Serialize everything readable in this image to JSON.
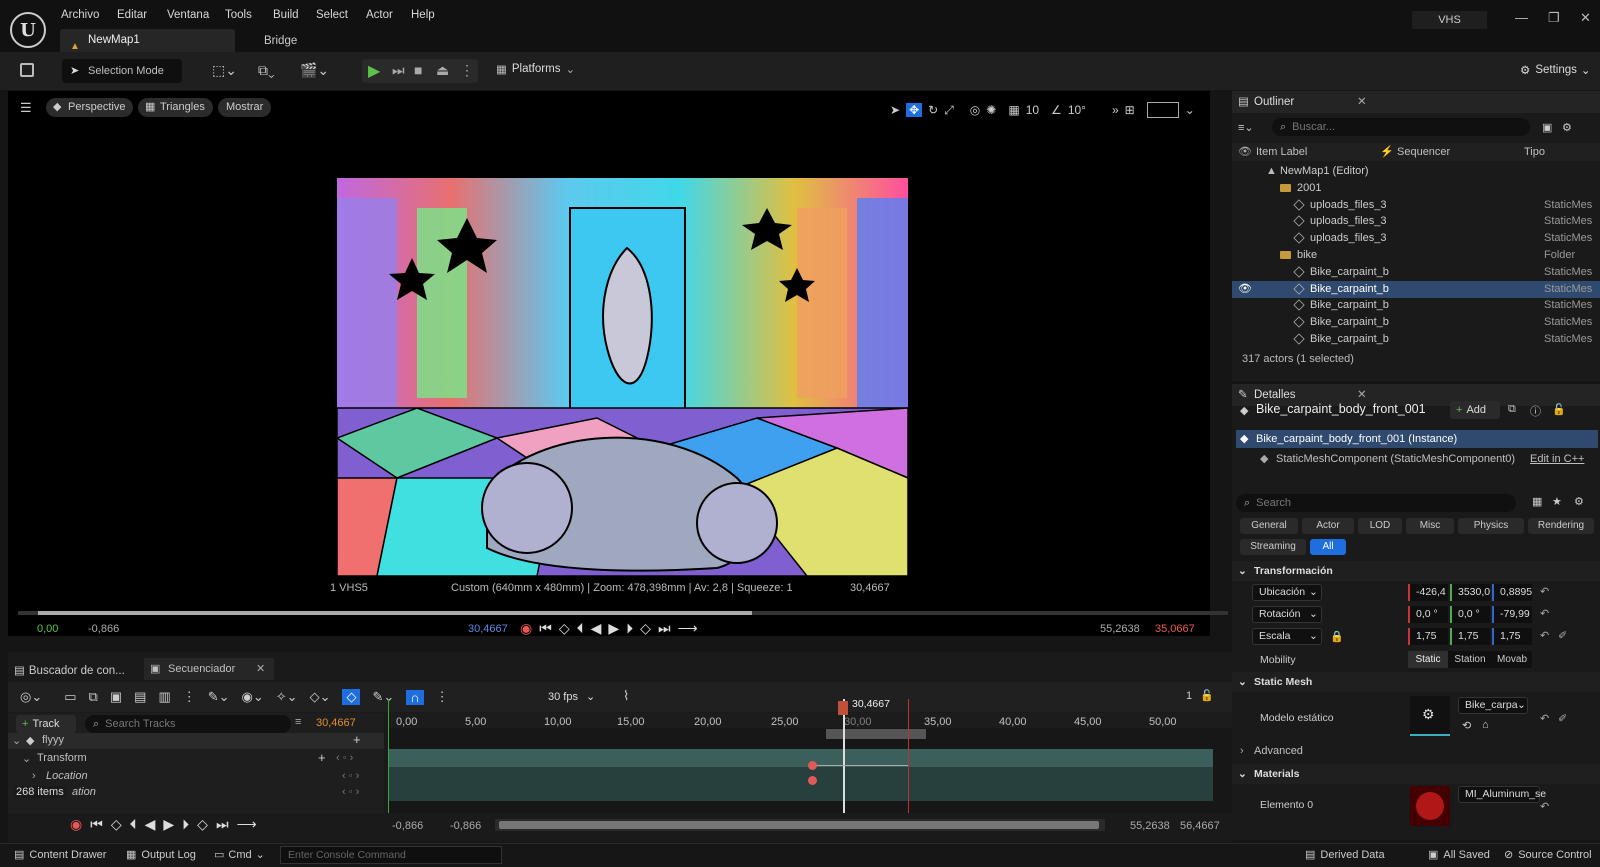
{
  "app": {
    "window_label": "VHS",
    "logo": "unreal-logo"
  },
  "menu": [
    "Archivo",
    "Editar",
    "Ventana",
    "Tools",
    "Build",
    "Select",
    "Actor",
    "Help"
  ],
  "tabs": {
    "map": "NewMap1",
    "bridge": "Bridge"
  },
  "toolbar": {
    "selection_mode": "Selection Mode",
    "platforms": "Platforms",
    "settings": "Settings"
  },
  "viewport": {
    "perspective": "Perspective",
    "triangles": "Triangles",
    "mostrar": "Mostrar",
    "grid_value": "10",
    "angle_value": "10°",
    "camera_name": "1 VHS5",
    "camera_info": "Custom (640mm x 480mm) | Zoom: 478,398mm | Av: 2,8 | Squeeze: 1",
    "camera_time": "30,4667"
  },
  "transport": {
    "start": "0,00",
    "in": "-0,866",
    "current": "30,4667",
    "out": "55,2638",
    "end": "35,0667",
    "progress": 0.6
  },
  "sequencer": {
    "tab_content": "Buscador de con...",
    "tab_sequencer": "Secuenciador",
    "fps": "30 fps",
    "count": "1",
    "track_button": "Track",
    "search_placeholder": "Search Tracks",
    "current_time": "30,4667",
    "playhead_label": "30,4667",
    "ticks": [
      "0,00",
      "5,00",
      "10,00",
      "15,00",
      "20,00",
      "25,00",
      "30,00",
      "35,00",
      "40,00",
      "45,00",
      "50,00"
    ],
    "tracks": [
      {
        "label": "flyyy"
      },
      {
        "label": "Transform"
      },
      {
        "label": "Location"
      },
      {
        "label": "ation"
      }
    ],
    "items_count": "268 items",
    "range_start": "-0,866",
    "range_start2": "-0,866",
    "range_end": "55,2638",
    "range_end2": "56,4667"
  },
  "outliner": {
    "title": "Outliner",
    "search_placeholder": "Buscar...",
    "columns": {
      "label": "Item Label",
      "seq": "Sequencer",
      "type": "Tipo"
    },
    "rows": [
      {
        "label": "NewMap1 (Editor)",
        "type": "",
        "indent": 1,
        "kind": "map"
      },
      {
        "label": "2001",
        "type": "",
        "indent": 2,
        "kind": "folder"
      },
      {
        "label": "uploads_files_3",
        "type": "StaticMes",
        "indent": 3,
        "kind": "mesh"
      },
      {
        "label": "uploads_files_3",
        "type": "StaticMes",
        "indent": 3,
        "kind": "mesh"
      },
      {
        "label": "uploads_files_3",
        "type": "StaticMes",
        "indent": 3,
        "kind": "mesh"
      },
      {
        "label": "bike",
        "type": "Folder",
        "indent": 2,
        "kind": "folder"
      },
      {
        "label": "Bike_carpaint_b",
        "type": "StaticMes",
        "indent": 3,
        "kind": "mesh"
      },
      {
        "label": "Bike_carpaint_b",
        "type": "StaticMes",
        "indent": 3,
        "kind": "mesh",
        "selected": true
      },
      {
        "label": "Bike_carpaint_b",
        "type": "StaticMes",
        "indent": 3,
        "kind": "mesh"
      },
      {
        "label": "Bike_carpaint_b",
        "type": "StaticMes",
        "indent": 3,
        "kind": "mesh"
      },
      {
        "label": "Bike_carpaint_b",
        "type": "StaticMes",
        "indent": 3,
        "kind": "mesh"
      }
    ],
    "status": "317 actors (1 selected)"
  },
  "details": {
    "title": "Detalles",
    "object_name": "Bike_carpaint_body_front_001",
    "add": "Add",
    "instance": "Bike_carpaint_body_front_001 (Instance)",
    "component": "StaticMeshComponent (StaticMeshComponent0)",
    "edit_cpp": "Edit in C++",
    "search_placeholder": "Search",
    "categories": [
      "General",
      "Actor",
      "LOD",
      "Misc",
      "Physics",
      "Rendering",
      "Streaming",
      "All"
    ],
    "transform_section": "Transformación",
    "ubicacion": {
      "label": "Ubicación",
      "x": "-426,4",
      "y": "3530,0",
      "z": "0,8895"
    },
    "rotacion": {
      "label": "Rotación",
      "x": "0,0 °",
      "y": "0,0 °",
      "z": "-79,99"
    },
    "escala": {
      "label": "Escala",
      "x": "1,75",
      "y": "1,75",
      "z": "1,75"
    },
    "mobility": {
      "label": "Mobility",
      "opts": [
        "Static",
        "Station",
        "Movab"
      ]
    },
    "static_mesh_section": "Static Mesh",
    "modelo_label": "Modelo estático",
    "modelo_value": "Bike_carpa",
    "advanced": "Advanced",
    "materials_section": "Materials",
    "elemento_label": "Elemento 0",
    "material_value": "MI_Aluminum_se"
  },
  "statusbar": {
    "content_drawer": "Content Drawer",
    "output_log": "Output Log",
    "cmd": "Cmd",
    "console_placeholder": "Enter Console Command",
    "derived_data": "Derived Data",
    "all_saved": "All Saved",
    "source_control": "Source Control"
  }
}
